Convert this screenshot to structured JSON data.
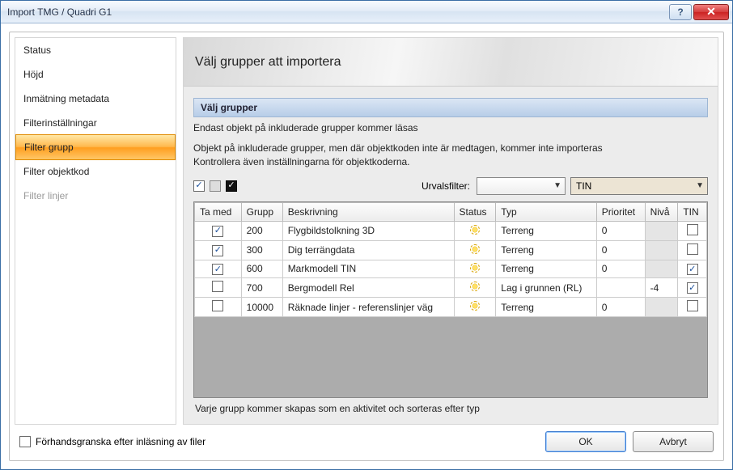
{
  "window": {
    "title": "Import TMG / Quadri G1"
  },
  "sidebar": {
    "items": [
      {
        "label": "Status"
      },
      {
        "label": "Höjd"
      },
      {
        "label": "Inmätning metadata"
      },
      {
        "label": "Filterinställningar"
      },
      {
        "label": "Filter grupp",
        "selected": true
      },
      {
        "label": "Filter objektkod"
      },
      {
        "label": "Filter linjer",
        "disabled": true
      }
    ]
  },
  "content": {
    "heading": "Välj grupper att importera",
    "section_title": "Välj grupper",
    "hint1": "Endast objekt på inkluderade grupper kommer läsas",
    "hint2a": "Objekt på inkluderade grupper, men där objektkoden inte är medtagen, kommer inte importeras",
    "hint2b": "Kontrollera även inställningarna för objektkoderna."
  },
  "filter": {
    "label": "Urvalsfilter:",
    "combo1": "",
    "combo2": "TIN",
    "checks": {
      "a": true,
      "b": false,
      "c": true
    }
  },
  "grid": {
    "headers": {
      "tamed": "Ta med",
      "grupp": "Grupp",
      "beskrivning": "Beskrivning",
      "status": "Status",
      "typ": "Typ",
      "prioritet": "Prioritet",
      "niva": "Nivå",
      "tin": "TIN"
    },
    "rows": [
      {
        "tamed": true,
        "grupp": "200",
        "beskrivning": "Flygbildstolkning 3D",
        "typ": "Terreng",
        "prioritet": "0",
        "niva": "",
        "tin": false
      },
      {
        "tamed": true,
        "grupp": "300",
        "beskrivning": "Dig terrängdata",
        "typ": "Terreng",
        "prioritet": "0",
        "niva": "",
        "tin": false
      },
      {
        "tamed": true,
        "grupp": "600",
        "beskrivning": "Markmodell TIN",
        "typ": "Terreng",
        "prioritet": "0",
        "niva": "",
        "tin": true
      },
      {
        "tamed": false,
        "grupp": "700",
        "beskrivning": "Bergmodell Rel",
        "typ": "Lag i grunnen (RL)",
        "prioritet": "",
        "niva": "-4",
        "tin": true
      },
      {
        "tamed": false,
        "grupp": "10000",
        "beskrivning": "Räknade linjer - referenslinjer väg",
        "typ": "Terreng",
        "prioritet": "0",
        "niva": "",
        "tin": false
      }
    ],
    "footer": "Varje grupp kommer skapas som en aktivitet och sorteras efter typ"
  },
  "bottom": {
    "preview_label": "Förhandsgranska efter inläsning av filer",
    "preview_checked": false,
    "ok": "OK",
    "cancel": "Avbryt"
  }
}
